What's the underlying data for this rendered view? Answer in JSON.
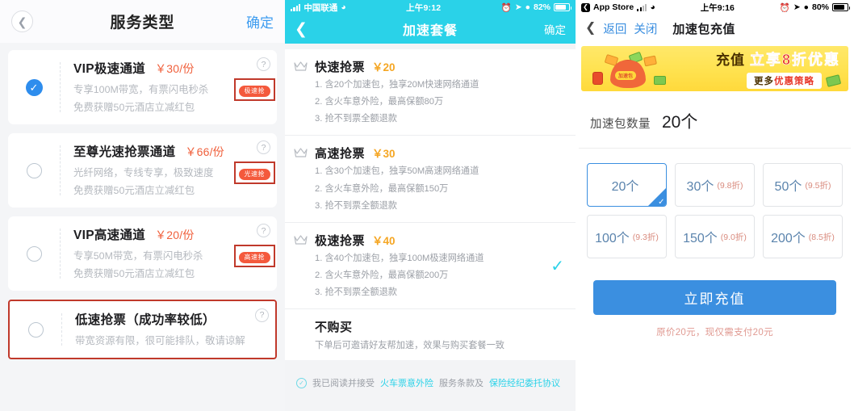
{
  "panel1": {
    "nav": {
      "back_icon": "chevron-left-icon",
      "title": "服务类型",
      "confirm": "确定"
    },
    "options": [
      {
        "name": "VIP极速通道",
        "price": "￥30/份",
        "desc1": "专享100M带宽，有票闪电秒杀",
        "desc2": "免费获赠50元酒店立减红包",
        "badge": "极速抢",
        "help": "?",
        "selected": true,
        "outlined": false
      },
      {
        "name": "至尊光速抢票通道",
        "price": "￥66/份",
        "desc1": "光纤网络，专线专享，极致速度",
        "desc2": "免费获赠50元酒店立减红包",
        "badge": "光速抢",
        "help": "?",
        "selected": false,
        "outlined": false
      },
      {
        "name": "VIP高速通道",
        "price": "￥20/份",
        "desc1": "专享50M带宽，有票闪电秒杀",
        "desc2": "免费获赠50元酒店立减红包",
        "badge": "高速抢",
        "help": "?",
        "selected": false,
        "outlined": false
      },
      {
        "name": "低速抢票（成功率较低）",
        "price": "",
        "desc1": "带宽资源有限，很可能排队，敬请谅解",
        "desc2": "",
        "badge": "",
        "help": "?",
        "selected": false,
        "outlined": true
      }
    ]
  },
  "panel2": {
    "status": {
      "carrier": "中国联通",
      "time": "上午9:12",
      "battery": "82%"
    },
    "nav": {
      "back_icon": "chevron-left-icon",
      "title": "加速套餐",
      "confirm": "确定"
    },
    "packages": [
      {
        "name": "快速抢票",
        "price": "￥20",
        "lines": [
          "1. 含20个加速包，独享20M快速网络通道",
          "2. 含火车意外险，最高保额80万",
          "3. 抢不到票全额退款"
        ],
        "selected": false
      },
      {
        "name": "高速抢票",
        "price": "￥30",
        "lines": [
          "1. 含30个加速包，独享50M高速网络通道",
          "2. 含火车意外险，最高保额150万",
          "3. 抢不到票全额退款"
        ],
        "selected": false
      },
      {
        "name": "极速抢票",
        "price": "￥40",
        "lines": [
          "1. 含40个加速包，独享100M极速网络通道",
          "2. 含火车意外险，最高保额200万",
          "3. 抢不到票全额退款"
        ],
        "selected": true
      }
    ],
    "no_buy": {
      "name": "不购买",
      "desc": "下单后可邀请好友帮加速，效果与购买套餐一致"
    },
    "agreement": {
      "prefix": "我已阅读并接受",
      "link1": "火车票意外险",
      "middle": "服务条款及",
      "link2": "保险经纪委托协议"
    }
  },
  "panel3": {
    "status": {
      "app": "App Store",
      "time": "上午9:16",
      "battery": "80%"
    },
    "nav": {
      "back": "返回",
      "close": "关闭",
      "title": "加速包充值"
    },
    "banner": {
      "word1": "充值",
      "word2": "立享8折优惠",
      "pill_pre": "更多",
      "pill_em": "优惠策略",
      "bag_tag": "加速包"
    },
    "qty": {
      "label": "加速包数量",
      "value": "20个"
    },
    "options": [
      {
        "count": "20个",
        "discount": "",
        "selected": true
      },
      {
        "count": "30个",
        "discount": "(9.8折)",
        "selected": false
      },
      {
        "count": "50个",
        "discount": "(9.5折)",
        "selected": false
      },
      {
        "count": "100个",
        "discount": "(9.3折)",
        "selected": false
      },
      {
        "count": "150个",
        "discount": "(9.0折)",
        "selected": false
      },
      {
        "count": "200个",
        "discount": "(8.5折)",
        "selected": false
      }
    ],
    "cta": "立即充值",
    "note": "原价20元，现仅需支付20元"
  }
}
